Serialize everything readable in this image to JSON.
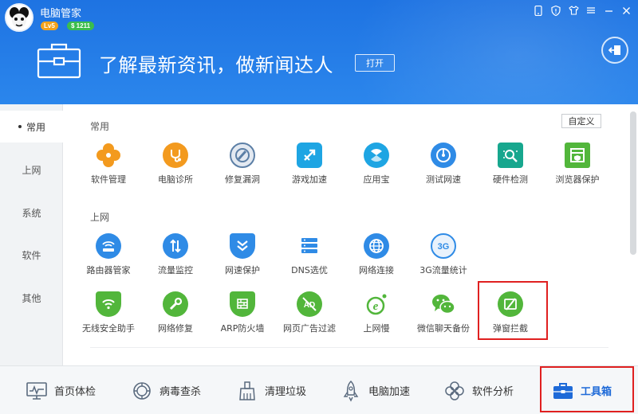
{
  "app": {
    "title": "电脑管家",
    "level": "Lv5",
    "coins": "$ 1211"
  },
  "banner": {
    "headline": "了解最新资讯，做新闻达人",
    "open_label": "打开"
  },
  "left_nav": [
    {
      "label": "常用",
      "active": true
    },
    {
      "label": "上网",
      "active": false
    },
    {
      "label": "系统",
      "active": false
    },
    {
      "label": "软件",
      "active": false
    },
    {
      "label": "其他",
      "active": false
    }
  ],
  "content": {
    "customize_label": "自定义",
    "sections": [
      {
        "title": "常用"
      },
      {
        "title": "上网"
      }
    ],
    "common_tools": [
      {
        "label": "软件管理",
        "icon": "clover-icon",
        "color": "#f39a1e"
      },
      {
        "label": "电脑诊所",
        "icon": "stethoscope-icon",
        "color": "#f39a1e"
      },
      {
        "label": "修复漏洞",
        "icon": "repair-icon",
        "color": "#5c7fa6"
      },
      {
        "label": "游戏加速",
        "icon": "game-icon",
        "color": "#1ea5e3"
      },
      {
        "label": "应用宝",
        "icon": "app-store-icon",
        "color": "#1ea5e3"
      },
      {
        "label": "测试网速",
        "icon": "speed-test-icon",
        "color": "#2f8be6"
      },
      {
        "label": "硬件检测",
        "icon": "hardware-icon",
        "color": "#17a78e"
      },
      {
        "label": "浏览器保护",
        "icon": "browser-shield-icon",
        "color": "#52b63b"
      }
    ],
    "internet_tools": [
      {
        "label": "路由器管家",
        "icon": "router-icon",
        "color": "#2f8be6"
      },
      {
        "label": "流量监控",
        "icon": "traffic-icon",
        "color": "#2f8be6"
      },
      {
        "label": "网速保护",
        "icon": "speed-shield-icon",
        "color": "#2f8be6"
      },
      {
        "label": "DNS选优",
        "icon": "dns-icon",
        "color": "#2f8be6"
      },
      {
        "label": "网络连接",
        "icon": "globe-icon",
        "color": "#2f8be6"
      },
      {
        "label": "3G流量统计",
        "icon": "3g-icon",
        "color": "#2f8be6"
      },
      {
        "label": "无线安全助手",
        "icon": "wifi-shield-icon",
        "color": "#52b63b"
      },
      {
        "label": "网络修复",
        "icon": "wrench-icon",
        "color": "#52b63b"
      },
      {
        "label": "ARP防火墙",
        "icon": "firewall-icon",
        "color": "#52b63b"
      },
      {
        "label": "网页广告过滤",
        "icon": "ad-filter-icon",
        "color": "#52b63b"
      },
      {
        "label": "上网慢",
        "icon": "slow-net-icon",
        "color": "#52b63b"
      },
      {
        "label": "微信聊天备份",
        "icon": "wechat-icon",
        "color": "#52b63b"
      },
      {
        "label": "弹窗拦截",
        "icon": "popup-block-icon",
        "color": "#52b63b"
      }
    ]
  },
  "bottom_bar": [
    {
      "label": "首页体检",
      "icon": "monitor-icon",
      "active": false
    },
    {
      "label": "病毒查杀",
      "icon": "virus-scan-icon",
      "active": false
    },
    {
      "label": "清理垃圾",
      "icon": "broom-icon",
      "active": false
    },
    {
      "label": "电脑加速",
      "icon": "rocket-icon",
      "active": false
    },
    {
      "label": "软件分析",
      "icon": "clover-outline-icon",
      "active": false
    },
    {
      "label": "工具箱",
      "icon": "toolbox-icon",
      "active": true
    }
  ],
  "colors": {
    "header_blue": "#1e73e2",
    "highlight_red": "#e02020",
    "active_blue": "#1e6ad8"
  }
}
